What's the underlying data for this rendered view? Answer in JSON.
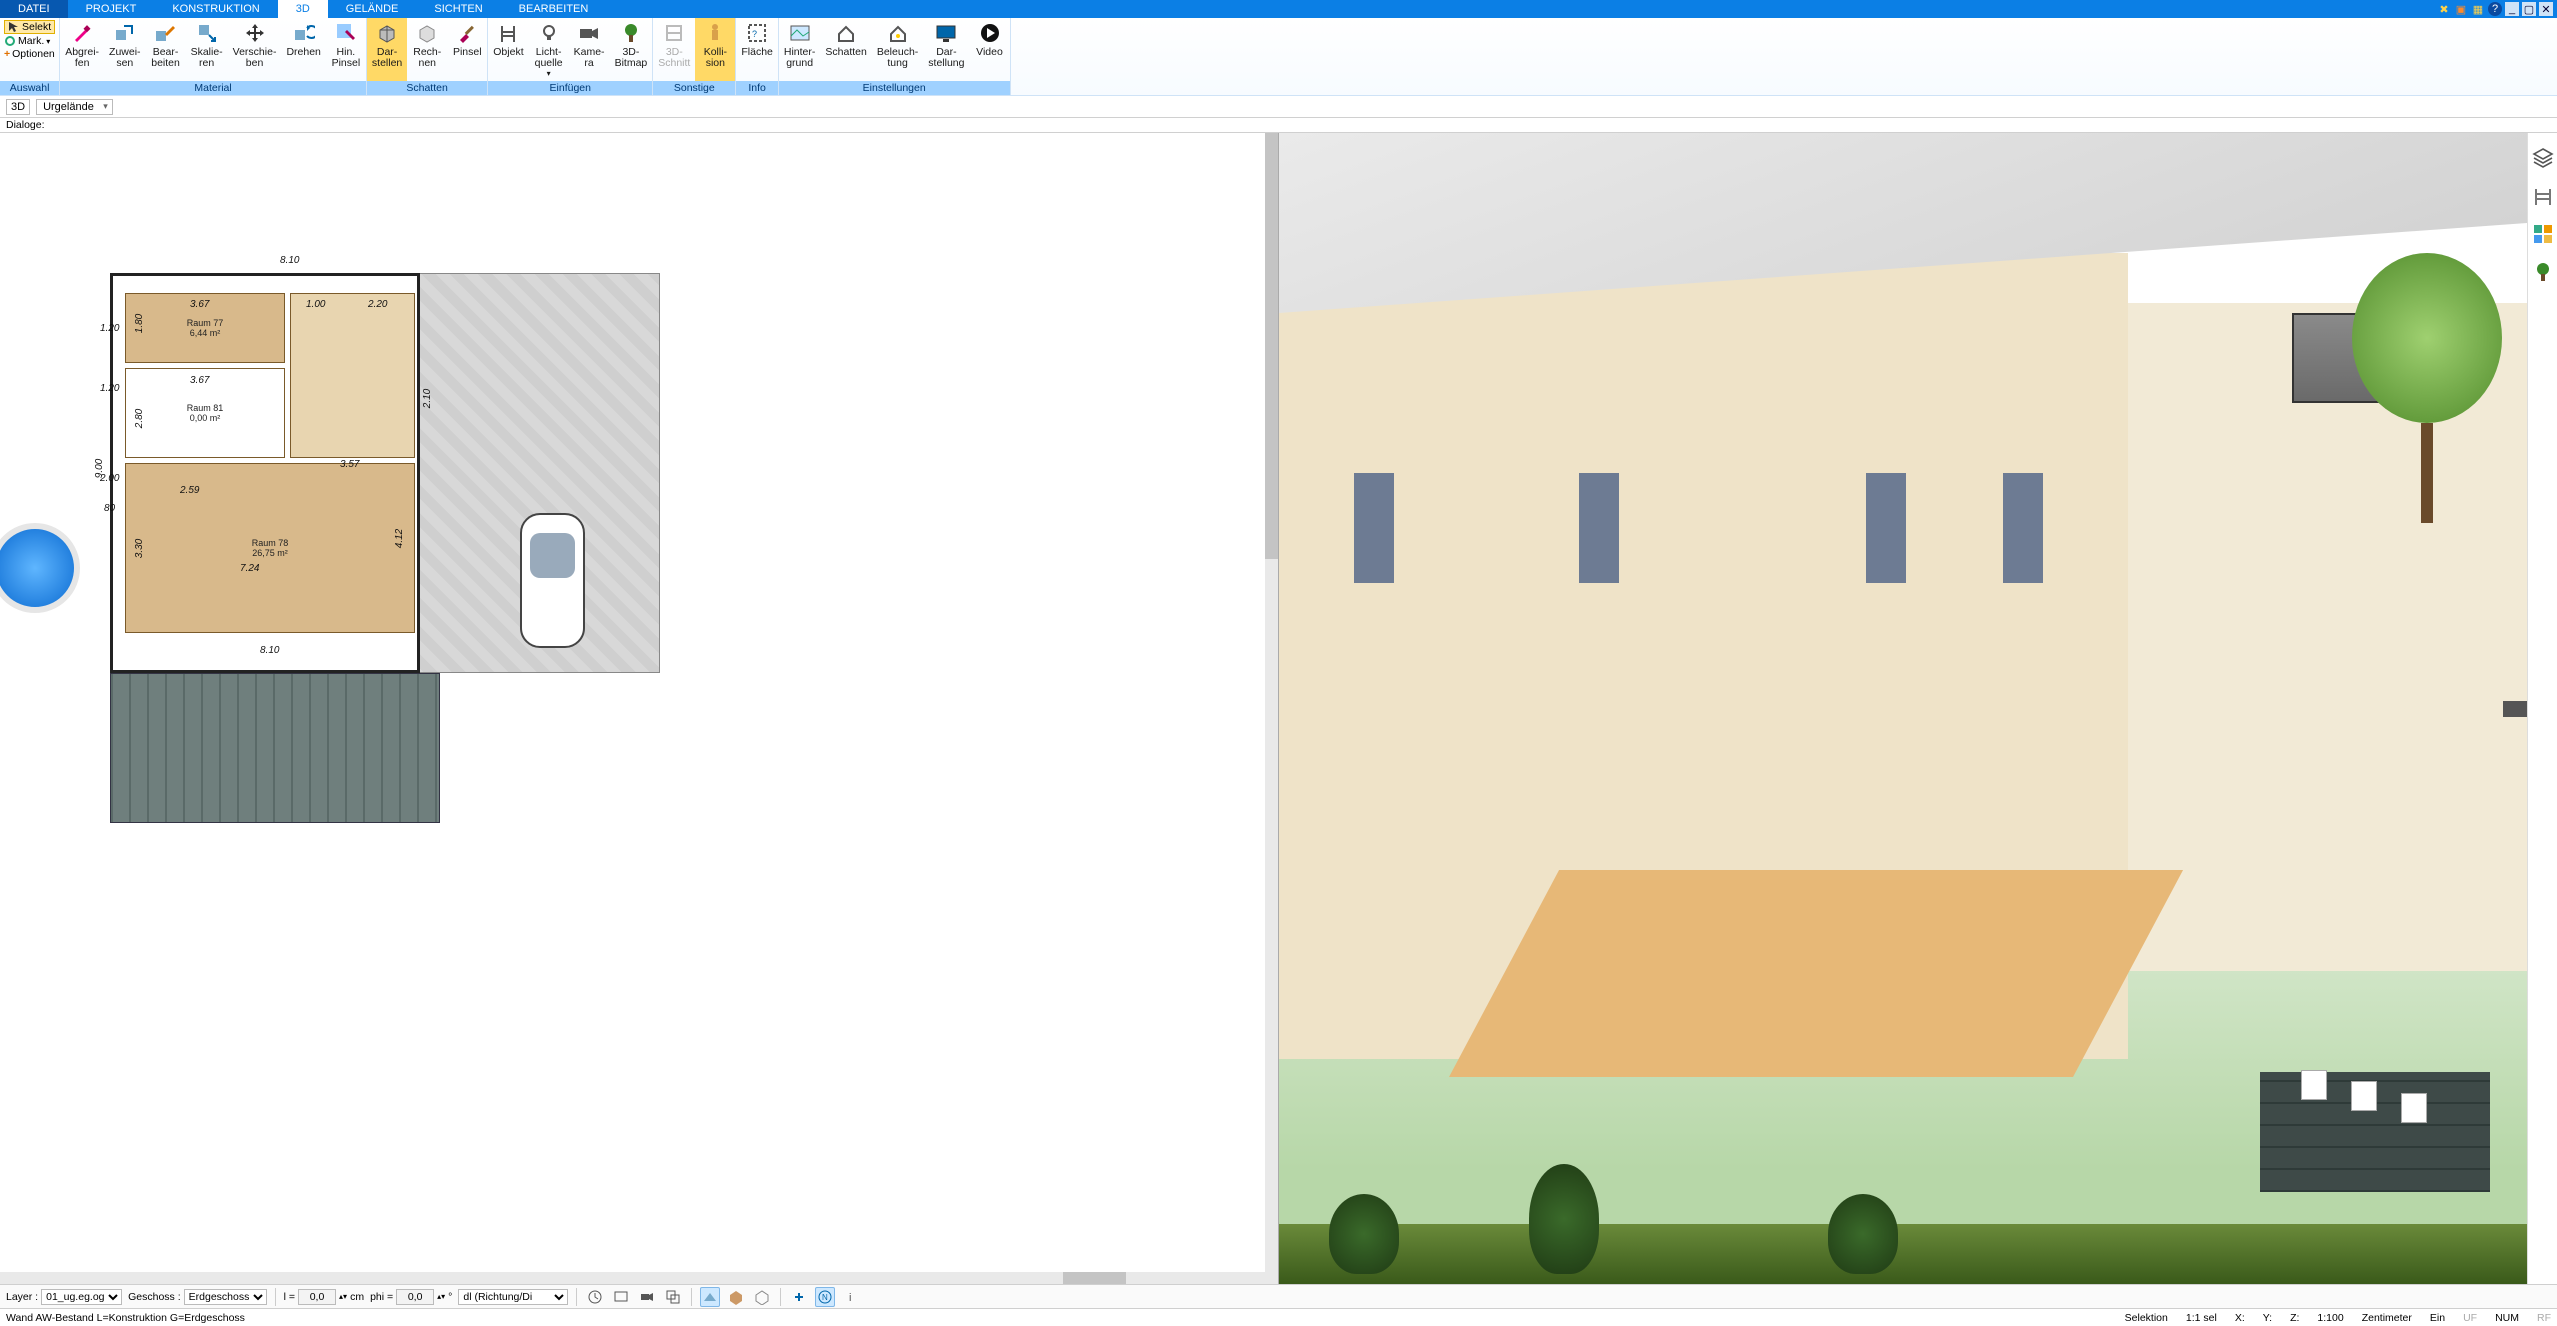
{
  "menu": {
    "tabs": [
      "DATEI",
      "PROJEKT",
      "KONSTRUKTION",
      "3D",
      "GELÄNDE",
      "SICHTEN",
      "BEARBEITEN"
    ],
    "active_index": 3
  },
  "ribbon": {
    "auswahl": {
      "selekt": "Selekt",
      "mark": "Mark.",
      "optionen": "Optionen",
      "group": "Auswahl"
    },
    "material": {
      "group": "Material",
      "abgreifen": "Abgrei-\nfen",
      "zuweisen": "Zuwei-\nsen",
      "bearbeiten": "Bear-\nbeiten",
      "skalieren": "Skalie-\nren",
      "verschieben": "Verschie-\nben",
      "drehen": "Drehen",
      "hinpinsel": "Hin.\nPinsel"
    },
    "schatten": {
      "group": "Schatten",
      "darstellen": "Dar-\nstellen",
      "rechnen": "Rech-\nnen",
      "pinsel": "Pinsel"
    },
    "einfuegen": {
      "group": "Einfügen",
      "objekt": "Objekt",
      "licht": "Licht-\nquelle",
      "kamera": "Kame-\nra",
      "bitmap": "3D-\nBitmap"
    },
    "sonstige": {
      "group": "Sonstige",
      "schnitt": "3D-\nSchnitt",
      "kollision": "Kolli-\nsion"
    },
    "info": {
      "group": "Info",
      "flaeche": "Fläche"
    },
    "einstellungen": {
      "group": "Einstellungen",
      "hintergrund": "Hinter-\ngrund",
      "schatten": "Schatten",
      "beleuchtung": "Beleuch-\ntung",
      "darstellung": "Dar-\nstellung",
      "video": "Video"
    }
  },
  "subbar": {
    "mode": "3D",
    "layer": "Urgelände"
  },
  "dialoge_label": "Dialoge:",
  "plan": {
    "dim_top": "8.10",
    "rooms": {
      "r77": {
        "name": "Raum 77",
        "area": "6,44 m²",
        "w": "3.67",
        "h": "1.80"
      },
      "r81": {
        "name": "Raum 81",
        "area": "0,00 m²",
        "w": "3.67",
        "h": "2.80"
      },
      "r78": {
        "name": "Raum 78",
        "area": "26,75 m²",
        "w": "7.24",
        "h": "3.30"
      }
    },
    "dims": {
      "left_total": "9.00",
      "right_mid": "2.10",
      "mid1": "1.00",
      "mid2": "2.20",
      "seg_159": "2.59",
      "seg_357": "3.57",
      "seg_412": "4.12",
      "seg_120a": "1.20",
      "seg_120b": "1.20",
      "seg_200": "2.00",
      "seg_80": "80",
      "deck_810": "8.10"
    }
  },
  "toolstrip": {
    "layer_label": "Layer :",
    "layer_value": "01_ug.eg.og",
    "geschoss_label": "Geschoss :",
    "geschoss_value": "Erdgeschoss",
    "l_label": "l =",
    "l_value": "0,0",
    "l_unit": "cm",
    "phi_label": "phi =",
    "phi_value": "0,0",
    "phi_unit": "°",
    "richtung": "dl (Richtung/Di"
  },
  "status": {
    "left": "Wand AW-Bestand L=Konstruktion G=Erdgeschoss",
    "selektion": "Selektion",
    "sel": "1:1 sel",
    "x": "X:",
    "y": "Y:",
    "z": "Z:",
    "scale": "1:100",
    "unit": "Zentimeter",
    "ein": "Ein",
    "uf": "UF",
    "num": "NUM",
    "rf": "RF"
  }
}
